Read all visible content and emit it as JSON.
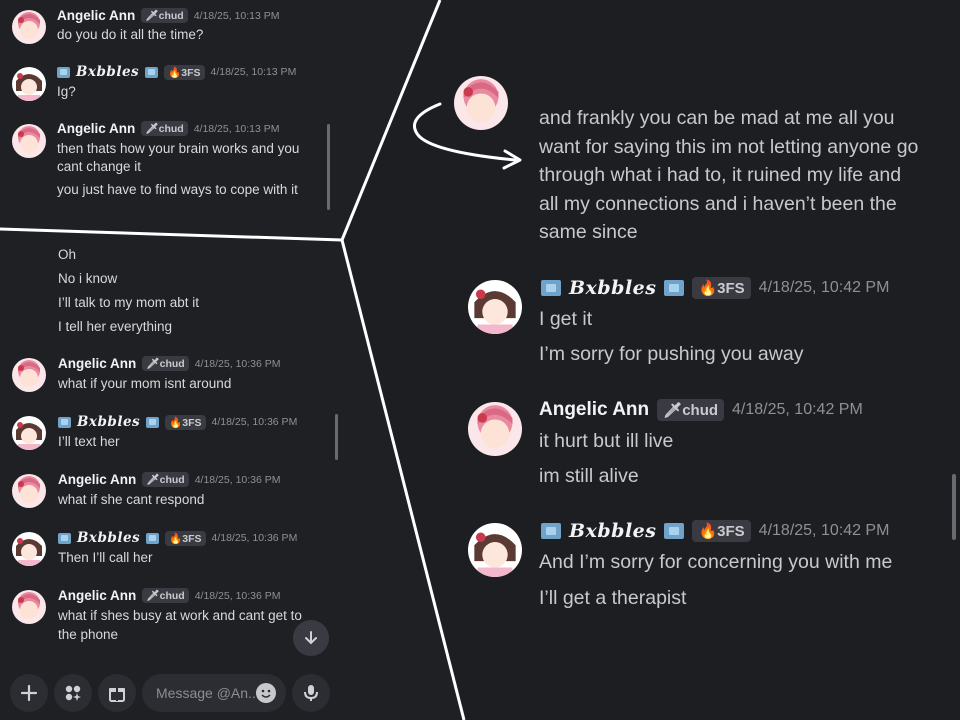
{
  "top_left": {
    "messages": [
      {
        "user": "Angelic Ann",
        "badge": "chud",
        "timestamp": "4/18/25, 10:13 PM",
        "lines": [
          "do you do it all the time?"
        ]
      },
      {
        "user": "𝑩𝒙𝒃𝒃𝒍𝒆𝒔",
        "badge": "3FS",
        "timestamp": "4/18/25, 10:13 PM",
        "lines": [
          "Ig?"
        ]
      },
      {
        "user": "Angelic Ann",
        "badge": "chud",
        "timestamp": "4/18/25, 10:13 PM",
        "lines": [
          "then thats how your brain works and you",
          "cant change it",
          "you just have to find ways to cope with it"
        ]
      }
    ]
  },
  "bottom_left": {
    "continuation_lines": [
      "Oh",
      "No i know",
      "I’ll talk to my mom abt it",
      "I tell her everything"
    ],
    "messages": [
      {
        "user": "Angelic Ann",
        "badge": "chud",
        "timestamp": "4/18/25, 10:36 PM",
        "lines": [
          "what if your mom isnt around"
        ]
      },
      {
        "user": "𝑩𝒙𝒃𝒃𝒍𝒆𝒔",
        "badge": "3FS",
        "timestamp": "4/18/25, 10:36 PM",
        "lines": [
          "I’ll text her"
        ]
      },
      {
        "user": "Angelic Ann",
        "badge": "chud",
        "timestamp": "4/18/25, 10:36 PM",
        "lines": [
          "what if she cant respond"
        ]
      },
      {
        "user": "𝑩𝒙𝒃𝒃𝒍𝒆𝒔",
        "badge": "3FS",
        "timestamp": "4/18/25, 10:36 PM",
        "lines": [
          "Then I’ll call her"
        ]
      },
      {
        "user": "Angelic Ann",
        "badge": "chud",
        "timestamp": "4/18/25, 10:36 PM",
        "lines": [
          "what if shes busy at work and cant get to",
          "the phone"
        ]
      }
    ],
    "input_placeholder": "Message @An..."
  },
  "right": {
    "first_message_lines": [
      "and frankly you can be mad at me all you",
      "want for saying this im not letting anyone go",
      "through what i had to, it ruined my life and",
      "all my connections and i haven’t been the",
      "same since"
    ],
    "messages": [
      {
        "user": "𝑩𝒙𝒃𝒃𝒍𝒆𝒔",
        "badge": "3FS",
        "timestamp": "4/18/25, 10:42 PM",
        "lines": [
          "I get it",
          "I’m sorry for pushing you away"
        ]
      },
      {
        "user": "Angelic Ann",
        "badge": "chud",
        "timestamp": "4/18/25, 10:42 PM",
        "lines": [
          "it hurt but ill live",
          "im still alive"
        ]
      },
      {
        "user": "𝑩𝒙𝒃𝒃𝒍𝒆𝒔",
        "badge": "3FS",
        "timestamp": "4/18/25, 10:42 PM",
        "lines": [
          "And I’m sorry for concerning you with me",
          "I’ll get a therapist"
        ]
      }
    ]
  },
  "icons": {
    "badge_chud": "sword-icon",
    "badge_3fs": "fire-icon",
    "cube": "ice-cube-icon",
    "jump": "arrow-down-icon",
    "plus": "plus-icon",
    "apps": "apps-icon",
    "gift": "gift-icon",
    "emoji": "emoji-icon",
    "mic": "microphone-icon"
  },
  "colors": {
    "background": "#1f2024",
    "name": "#f2f3f5",
    "timestamp": "#8e9097",
    "badge_bg": "#3a3b42",
    "annotation": "#ffffff"
  }
}
